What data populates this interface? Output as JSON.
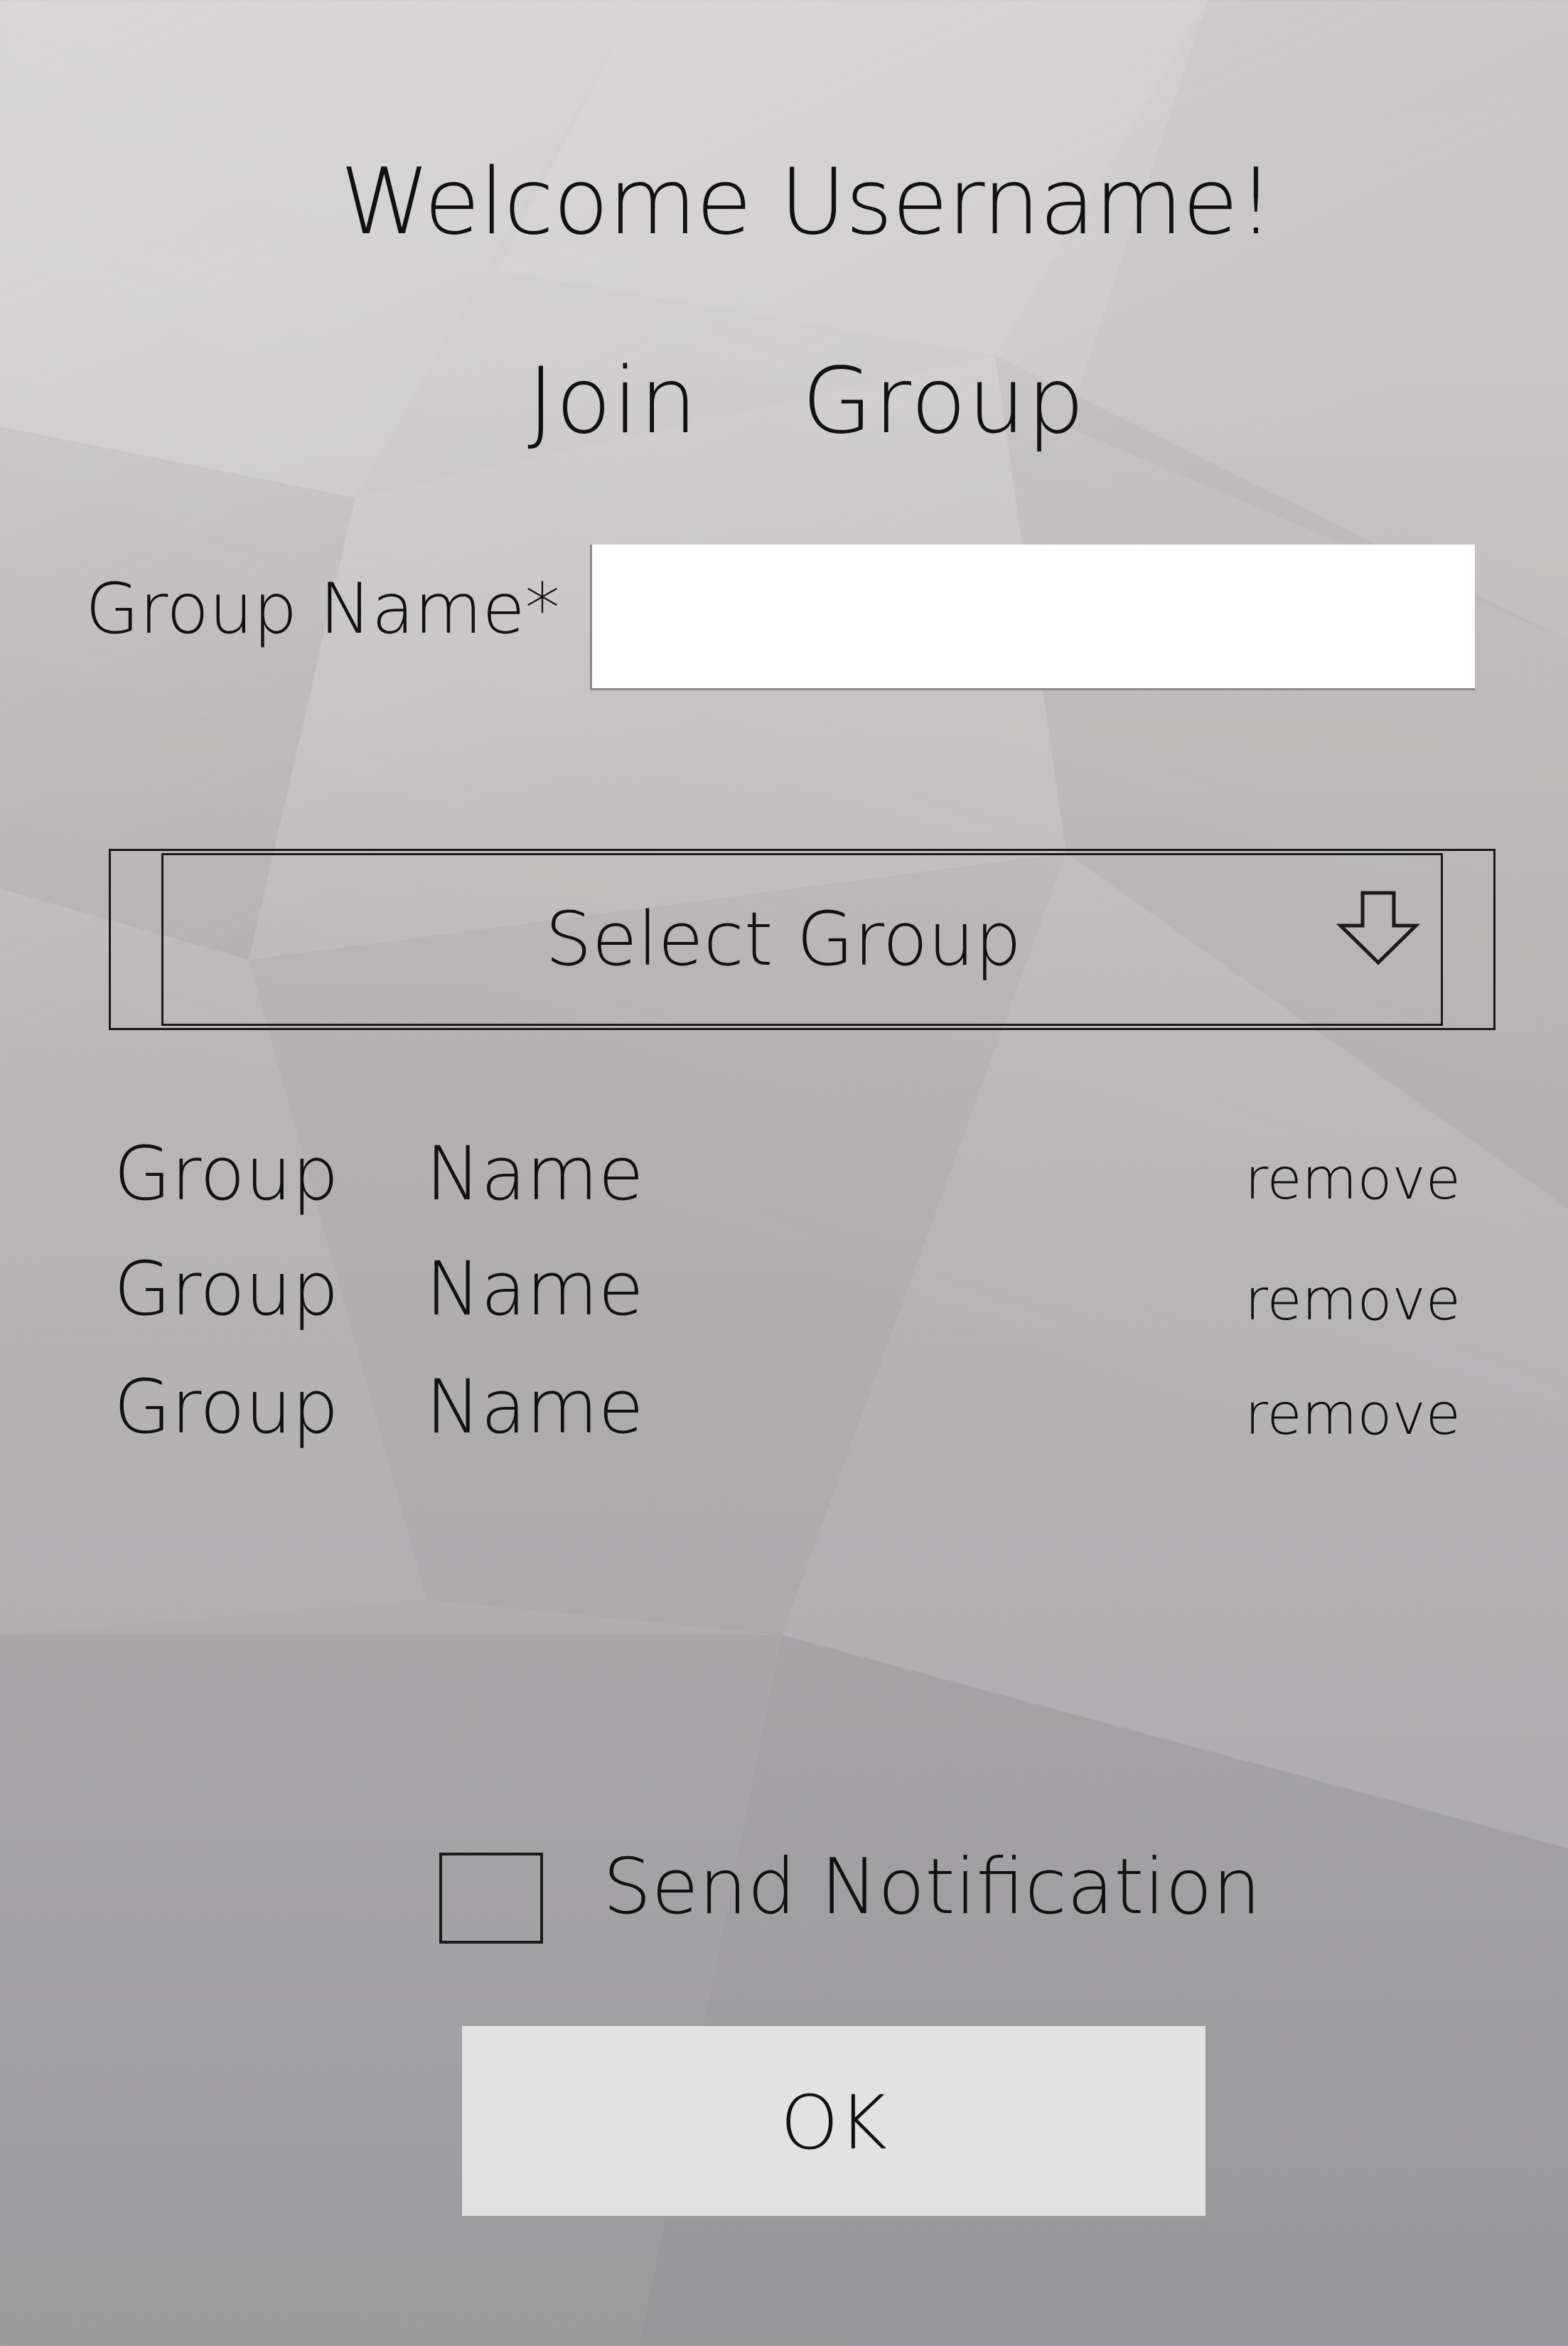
{
  "header": {
    "welcome": "Welcome Username!",
    "title": "Join  Group"
  },
  "form": {
    "group_name_label": "Group Name*",
    "group_name_value": "",
    "select_group_label": "Select Group",
    "dropdown_icon": "arrow-down-icon"
  },
  "groups": [
    {
      "name": "Group  Name",
      "action": "remove"
    },
    {
      "name": "Group  Name",
      "action": "remove"
    },
    {
      "name": "Group  Name",
      "action": "remove"
    }
  ],
  "notification": {
    "label": "Send Notification",
    "checked": false
  },
  "actions": {
    "ok_label": "OK"
  }
}
